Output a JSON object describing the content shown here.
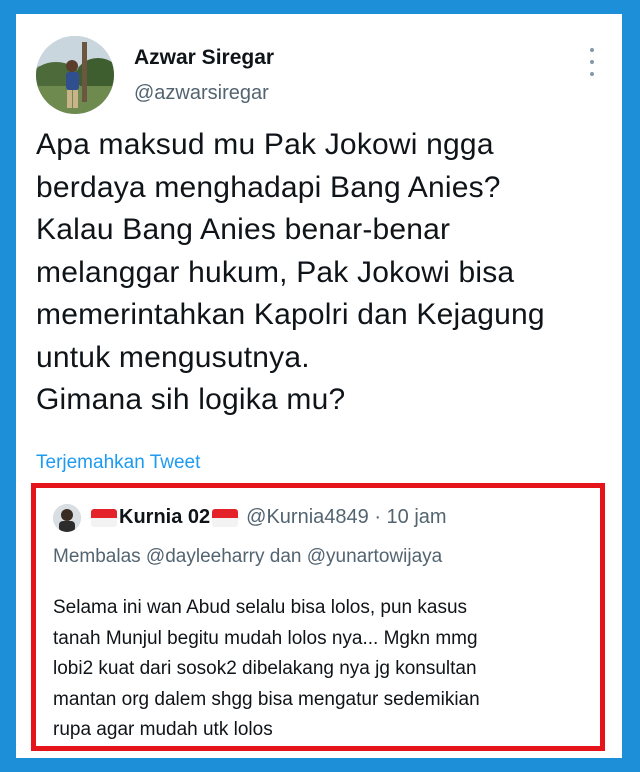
{
  "tweet": {
    "author_name": "Azwar Siregar",
    "author_handle": "@azwarsiregar",
    "text": "Apa maksud mu Pak Jokowi ngga\nberdaya menghadapi Bang Anies?\nKalau Bang Anies benar-benar\nmelanggar hukum, Pak Jokowi bisa\nmemerintahkan Kapolri dan Kejagung\nuntuk mengusutnya.\nGimana sih logika mu?",
    "translate_link": "Terjemahkan Tweet"
  },
  "quoted": {
    "author_name": "Kurnia 02",
    "author_handle_time": "@Kurnia4849 · 10 jam",
    "replying_to": "Membalas @dayleeharry dan @yunartowijaya",
    "text": "Selama ini wan Abud selalu bisa lolos, pun kasus\ntanah Munjul begitu mudah lolos nya... Mgkn mmg\nlobi2 kuat dari sosok2 dibelakang nya jg konsultan\nmantan org dalem shgg bisa mengatur sedemikian\nrupa agar mudah utk lolos"
  },
  "icons": {
    "more": "more-vertical-icon",
    "flag": "indonesia-flag-icon"
  },
  "colors": {
    "background": "#1d8fd8",
    "link": "#1d9bf0",
    "highlight_border": "#e5141a"
  }
}
